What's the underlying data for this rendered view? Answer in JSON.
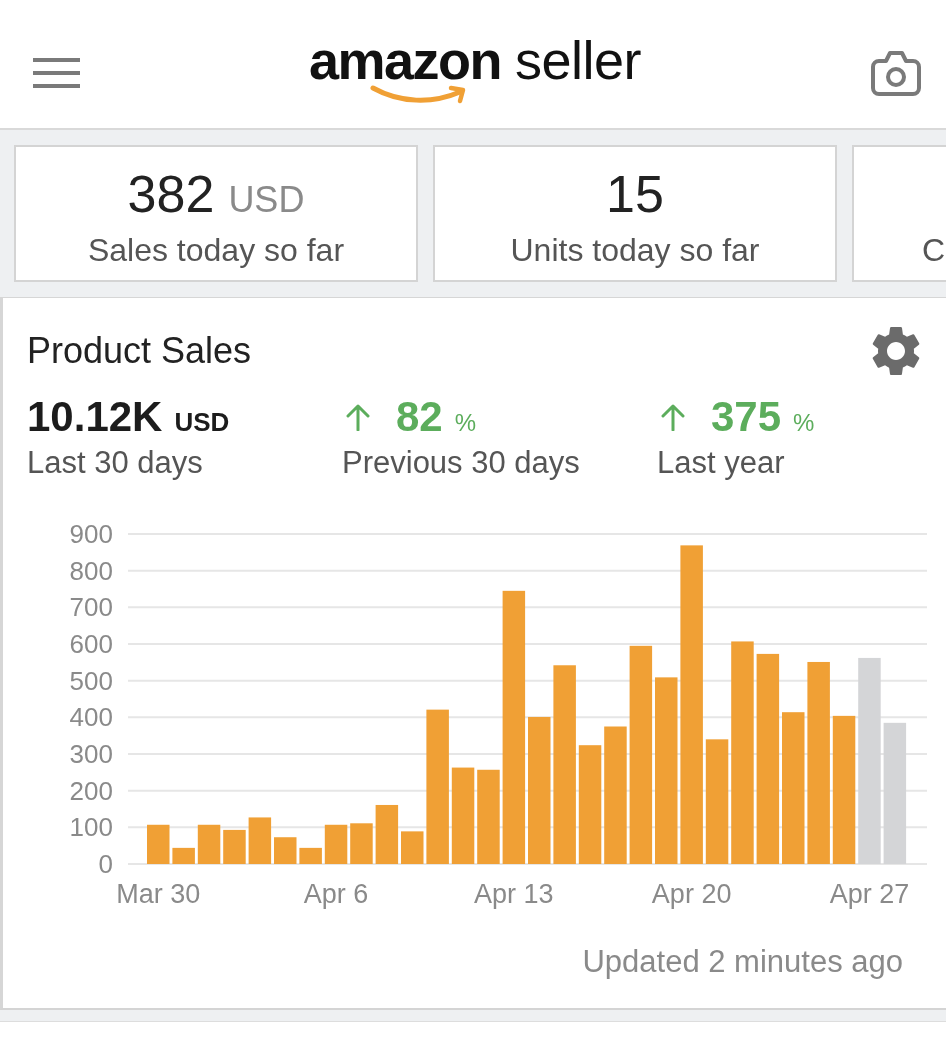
{
  "header": {
    "logo": {
      "brand": "amazon",
      "product": "seller"
    }
  },
  "summary_cards": [
    {
      "value": "382",
      "unit": "USD",
      "label": "Sales today so far"
    },
    {
      "value": "15",
      "label": "Units today so far"
    },
    {
      "label": "C"
    }
  ],
  "product_sales": {
    "title": "Product Sales",
    "metrics": [
      {
        "kind": "total",
        "value": "10.12K",
        "unit": "USD",
        "label": "Last 30 days"
      },
      {
        "kind": "change",
        "up": true,
        "value": "82",
        "unit": "%",
        "label": "Previous 30 days"
      },
      {
        "kind": "change",
        "up": true,
        "value": "375",
        "unit": "%",
        "label": "Last year"
      }
    ],
    "chart_data": {
      "type": "bar",
      "stacked": true,
      "grid": true,
      "ylim": [
        0,
        900
      ],
      "yticks": [
        0,
        100,
        200,
        300,
        400,
        500,
        600,
        700,
        800,
        900
      ],
      "categories": [
        "Mar 30",
        null,
        null,
        null,
        null,
        null,
        null,
        "Apr 6",
        null,
        null,
        null,
        null,
        null,
        null,
        "Apr 13",
        null,
        null,
        null,
        null,
        null,
        null,
        "Apr 20",
        null,
        null,
        null,
        null,
        null,
        null,
        "Apr 27",
        null
      ],
      "series": [
        {
          "color": "#f0a035",
          "values": [
            107,
            44,
            107,
            93,
            127,
            73,
            44,
            107,
            111,
            161,
            89,
            421,
            263,
            257,
            745,
            401,
            542,
            324,
            375,
            595,
            509,
            869,
            340,
            607,
            573,
            414,
            551,
            404,
            null,
            null
          ]
        },
        {
          "color": "#d4d5d7",
          "values": [
            null,
            null,
            null,
            null,
            null,
            null,
            null,
            null,
            null,
            null,
            null,
            null,
            null,
            null,
            null,
            null,
            null,
            null,
            null,
            null,
            null,
            null,
            null,
            null,
            null,
            null,
            null,
            null,
            562,
            385
          ]
        }
      ]
    },
    "updated": "Updated 2 minutes ago"
  }
}
